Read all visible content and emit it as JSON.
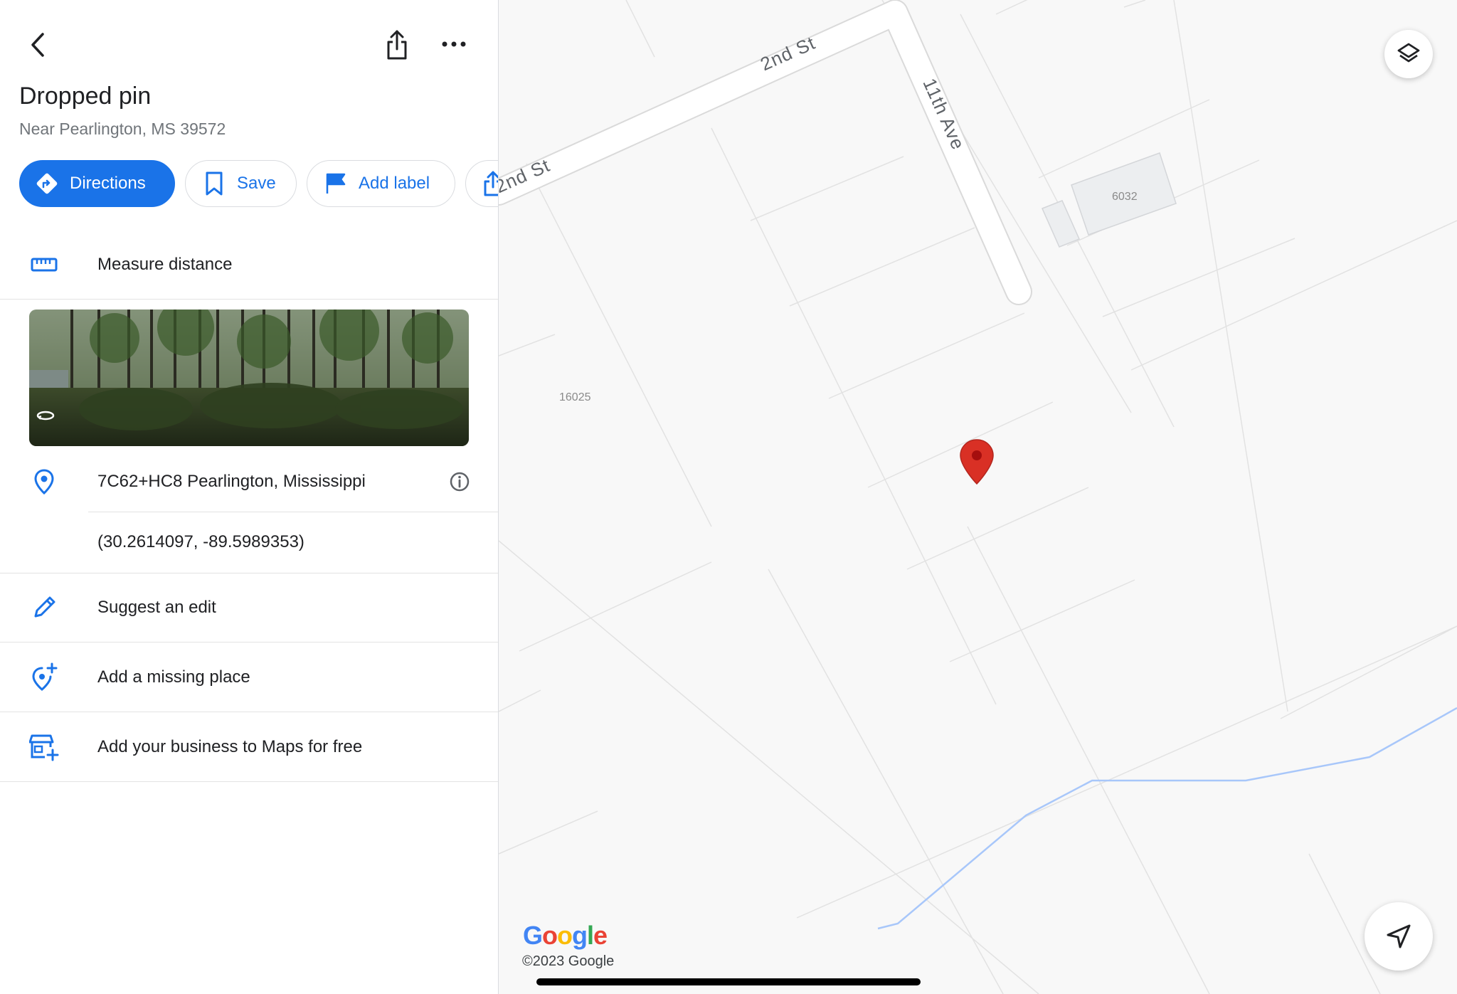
{
  "header": {
    "back_icon": "chevron-left-icon",
    "share_icon": "share-icon",
    "more_icon": "more-horizontal-icon"
  },
  "place": {
    "title": "Dropped pin",
    "subtitle": "Near Pearlington, MS 39572"
  },
  "actions": {
    "directions": "Directions",
    "save": "Save",
    "add_label": "Add label"
  },
  "measure": {
    "label": "Measure distance",
    "icon": "ruler-icon"
  },
  "photo": {
    "icon": "360-rotate-icon"
  },
  "address": {
    "plus_code": "7C62+HC8 Pearlington, Mississippi",
    "coordinates": "(30.2614097, -89.5989353)",
    "pin_icon": "location-pin-icon",
    "info_icon": "info-icon"
  },
  "menu": {
    "suggest_edit": "Suggest an edit",
    "add_missing_place": "Add a missing place",
    "add_business": "Add your business to Maps for free"
  },
  "map": {
    "roads": {
      "street_a": "2nd St",
      "street_b": "2nd St",
      "avenue": "11th Ave"
    },
    "parcels": {
      "p1": "16025",
      "p2": "6032"
    },
    "logo": "Google",
    "copyright": "©2023 Google",
    "layers_icon": "layers-icon",
    "locate_icon": "navigation-arrow-icon",
    "colors": {
      "pin": "#d93025",
      "water": "#a8c7fa",
      "accent": "#1a73e8"
    }
  }
}
